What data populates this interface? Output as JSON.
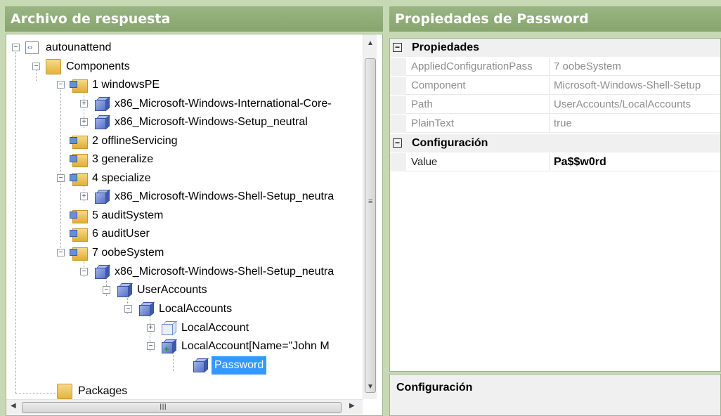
{
  "left_pane": {
    "title": "Archivo de respuesta",
    "tree": {
      "root": "autounattend",
      "components": "Components",
      "windowsPE": "1 windowsPE",
      "intl_core": "x86_Microsoft-Windows-International-Core-",
      "setup": "x86_Microsoft-Windows-Setup_neutral",
      "offline": "2 offlineServicing",
      "generalize": "3 generalize",
      "specialize": "4 specialize",
      "shell_setup_specialize": "x86_Microsoft-Windows-Shell-Setup_neutra",
      "audit_system": "5 auditSystem",
      "audit_user": "6 auditUser",
      "oobe": "7 oobeSystem",
      "shell_setup_oobe": "x86_Microsoft-Windows-Shell-Setup_neutra",
      "user_accounts": "UserAccounts",
      "local_accounts": "LocalAccounts",
      "local_account": "LocalAccount",
      "local_account_named": "LocalAccount[Name=\"John M",
      "password": "Password",
      "packages": "Packages"
    },
    "scroll_grip": "≡",
    "hscroll_grip": "III"
  },
  "right_pane": {
    "title": "Propiedades de Password",
    "categories": [
      {
        "label": "Propiedades",
        "toggle": "⊟"
      },
      {
        "label": "Configuración",
        "toggle": "⊟"
      }
    ],
    "properties": [
      {
        "name": "AppliedConfigurationPass",
        "value": "7 oobeSystem"
      },
      {
        "name": "Component",
        "value": "Microsoft-Windows-Shell-Setup"
      },
      {
        "name": "Path",
        "value": "UserAccounts/LocalAccounts"
      },
      {
        "name": "PlainText",
        "value": "true"
      }
    ],
    "config_property": {
      "name": "Value",
      "value": "Pa$$w0rd"
    },
    "description_title": "Configuración"
  },
  "colors": {
    "header": "#86a56e",
    "selection": "#3399ff",
    "background": "#c7d9b4"
  }
}
